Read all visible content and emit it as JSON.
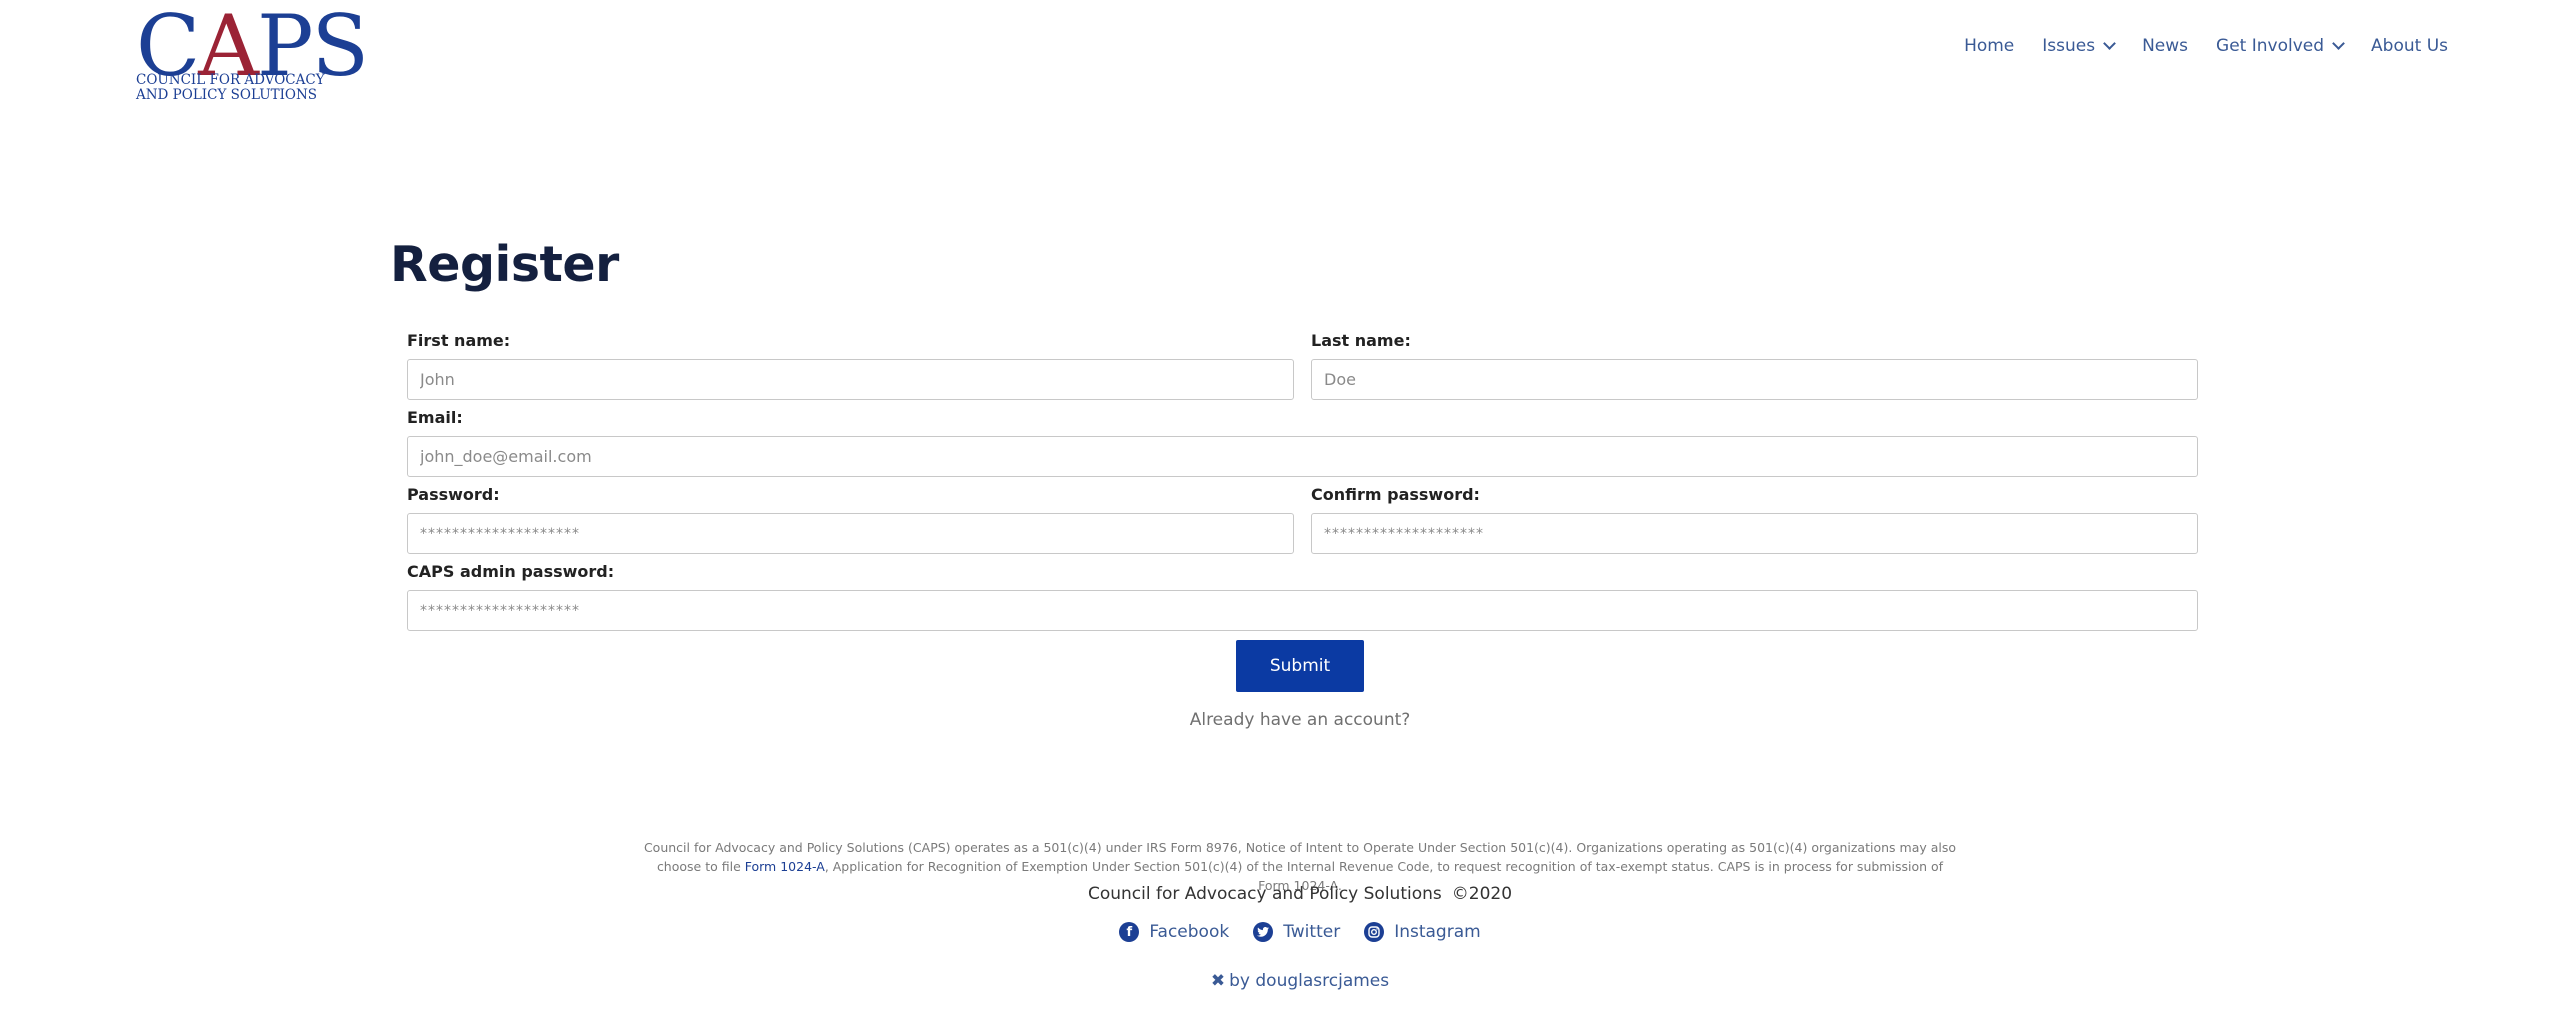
{
  "header": {
    "logo": {
      "mark_c": "C",
      "mark_a": "A",
      "mark_ps": "PS",
      "line1": "COUNCIL FOR ADVOCACY",
      "line2": "AND POLICY SOLUTIONS"
    },
    "nav": [
      {
        "label": "Home",
        "has_dropdown": false
      },
      {
        "label": "Issues",
        "has_dropdown": true
      },
      {
        "label": "News",
        "has_dropdown": false
      },
      {
        "label": "Get Involved",
        "has_dropdown": true
      },
      {
        "label": "About Us",
        "has_dropdown": false
      }
    ]
  },
  "form": {
    "title": "Register",
    "first_name": {
      "label": "First name:",
      "placeholder": "John"
    },
    "last_name": {
      "label": "Last name:",
      "placeholder": "Doe"
    },
    "email": {
      "label": "Email:",
      "placeholder": "john_doe@email.com"
    },
    "password": {
      "label": "Password:",
      "placeholder": "********************"
    },
    "confirm_password": {
      "label": "Confirm password:",
      "placeholder": "********************"
    },
    "admin_password": {
      "label": "CAPS admin password:",
      "placeholder": "********************"
    },
    "submit_label": "Submit",
    "login_link": "Already have an account?"
  },
  "footer": {
    "disclaimer_part1": "Council for Advocacy and Policy Solutions (CAPS) operates as a 501(c)(4) under IRS Form 8976, Notice of Intent to Operate Under Section 501(c)(4). Organizations operating as 501(c)(4) organizations may also choose to file ",
    "disclaimer_link": "Form 1024-A",
    "disclaimer_part2": ", Application for Recognition of Exemption Under Section 501(c)(4) of the Internal Revenue Code, to request recognition of tax-exempt status. CAPS is in process for submission of Form 1024-A.",
    "org_name": "Council for Advocacy and Policy Solutions",
    "copyright": "©2020",
    "social": [
      {
        "label": "Facebook",
        "icon": "facebook-icon"
      },
      {
        "label": "Twitter",
        "icon": "twitter-icon"
      },
      {
        "label": "Instagram",
        "icon": "instagram-icon"
      }
    ],
    "credit": "by douglasrcjames"
  },
  "colors": {
    "brand_blue": "#1c3f94",
    "brand_red": "#9b2335",
    "button_blue": "#0b3aa3",
    "nav_text": "#3a5a95",
    "title": "#14203f"
  }
}
